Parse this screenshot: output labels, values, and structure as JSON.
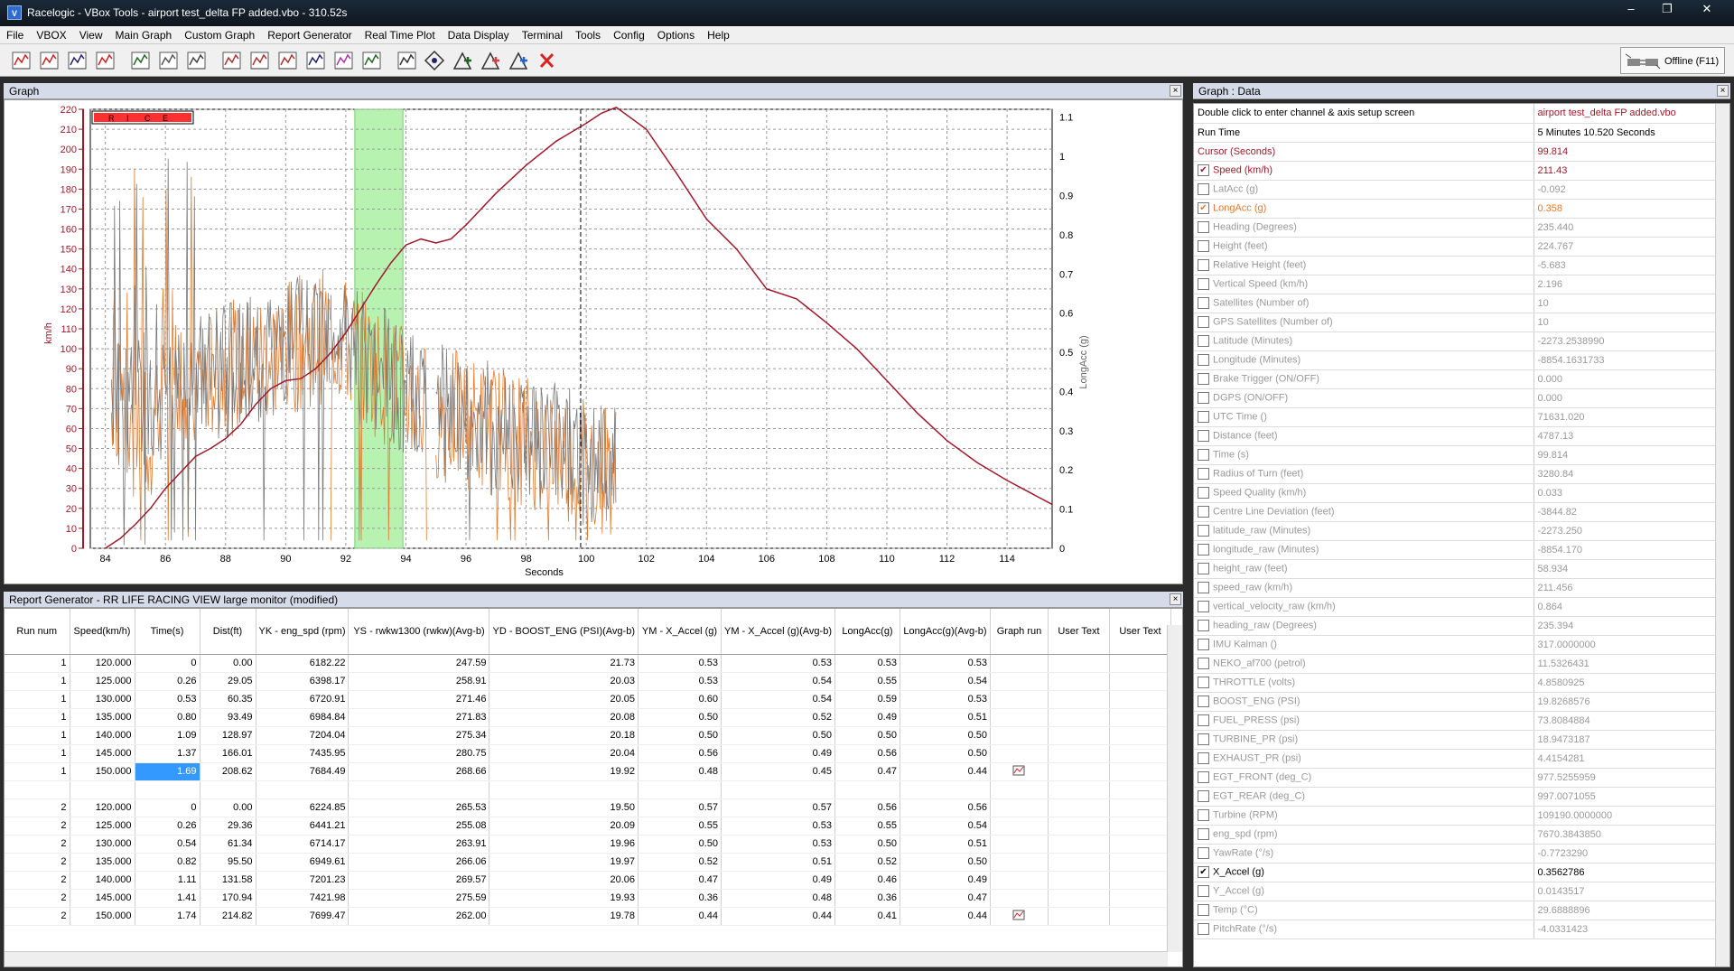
{
  "window": {
    "title": "Racelogic - VBox Tools - airport test_delta FP added.vbo - 310.52s",
    "icon": "V"
  },
  "menu": [
    "File",
    "VBOX",
    "View",
    "Main Graph",
    "Custom Graph",
    "Report Generator",
    "Real Time Plot",
    "Data Display",
    "Terminal",
    "Tools",
    "Config",
    "Options",
    "Help"
  ],
  "toolbar": {
    "icons": [
      "graph-icon",
      "graph-setup-icon",
      "zoom-graph-icon",
      "circle-graph-icon",
      "data-table-icon",
      "report-icon",
      "export-icon",
      "channel-icon",
      "channel-plot-icon",
      "lap-icon",
      "chart-icon",
      "cursor-icon",
      "map-icon",
      "table-icon",
      "compass-icon",
      "add-graph-icon",
      "add-graph-alt-icon",
      "add-graph-blue-icon",
      "delete-icon"
    ],
    "offline_label": "Offline (F11)"
  },
  "graph_panel": {
    "title": "Graph",
    "close": "×"
  },
  "report_panel": {
    "title": "Report Generator - RR LIFE RACING VIEW large monitor (modified)",
    "close": "×"
  },
  "data_panel": {
    "title": "Graph : Data",
    "close": "×"
  },
  "chart_data": {
    "type": "line",
    "xlabel": "Seconds",
    "ylabel_left": "km/h",
    "ylabel_right": "LongAcc (g)",
    "xlim": [
      83.5,
      115.5
    ],
    "ylim_left": [
      0,
      220
    ],
    "ylim_right": [
      0,
      1.12
    ],
    "x_ticks": [
      84,
      86,
      88,
      90,
      92,
      94,
      96,
      98,
      100,
      102,
      104,
      106,
      108,
      110,
      112,
      114
    ],
    "y_ticks_left": [
      0,
      10,
      20,
      30,
      40,
      50,
      60,
      70,
      80,
      90,
      100,
      110,
      120,
      130,
      140,
      150,
      160,
      170,
      180,
      190,
      200,
      210,
      220
    ],
    "y_ticks_right": [
      0,
      0.1,
      0.2,
      0.3,
      0.4,
      0.5,
      0.6,
      0.7,
      0.8,
      0.9,
      1,
      1.1
    ],
    "grid": true,
    "cursor_x": 99.814,
    "highlight_band": [
      92.3,
      93.9
    ],
    "legend_box": [
      "R",
      "I",
      "C",
      "E"
    ],
    "series": [
      {
        "name": "Speed (km/h)",
        "color": "#a0182a",
        "axis": "left",
        "x": [
          84,
          84.5,
          85,
          85.5,
          86,
          86.5,
          87,
          87.5,
          88,
          88.5,
          89,
          89.5,
          90,
          90.5,
          91,
          91.5,
          92,
          92.5,
          93,
          93.5,
          94,
          94.5,
          95,
          95.5,
          96,
          97,
          98,
          99,
          100,
          100.5,
          101,
          102,
          103,
          104,
          105,
          106,
          107,
          108,
          109,
          110,
          111,
          112,
          113,
          114,
          115,
          115.5
        ],
        "values": [
          0,
          5,
          12,
          20,
          30,
          38,
          46,
          50,
          55,
          62,
          72,
          80,
          84,
          85,
          90,
          98,
          108,
          120,
          132,
          143,
          152,
          155,
          153,
          155,
          162,
          178,
          192,
          204,
          213,
          218,
          221,
          210,
          188,
          165,
          150,
          130,
          125,
          113,
          100,
          84,
          68,
          54,
          43,
          34,
          26,
          22
        ]
      },
      {
        "name": "LongAcc (g)",
        "color": "#e07a2e",
        "axis": "right",
        "x": [],
        "values": []
      },
      {
        "name": "X_Accel (g)",
        "color": "#7a7a7a",
        "axis": "right",
        "x": [],
        "values": []
      }
    ]
  },
  "report": {
    "columns": [
      "Run num",
      "Speed(km/h)",
      "Time(s)",
      "Dist(ft)",
      "YK - eng_spd (rpm)",
      "YS - rwkw1300 (rwkw)(Avg-b)",
      "YD - BOOST_ENG (PSI)(Avg-b)",
      "YM - X_Accel (g)",
      "YM - X_Accel (g)(Avg-b)",
      "LongAcc(g)",
      "LongAcc(g)(Avg-b)",
      "Graph run",
      "User Text",
      "User Text"
    ],
    "rows": [
      [
        "1",
        "120.000",
        "0",
        "0.00",
        "6182.22",
        "247.59",
        "21.73",
        "0.53",
        "0.53",
        "0.53",
        "0.53",
        "",
        ""
      ],
      [
        "1",
        "125.000",
        "0.26",
        "29.05",
        "6398.17",
        "258.91",
        "20.03",
        "0.53",
        "0.54",
        "0.55",
        "0.54",
        "",
        ""
      ],
      [
        "1",
        "130.000",
        "0.53",
        "60.35",
        "6720.91",
        "271.46",
        "20.05",
        "0.60",
        "0.54",
        "0.59",
        "0.53",
        "",
        ""
      ],
      [
        "1",
        "135.000",
        "0.80",
        "93.49",
        "6984.84",
        "271.83",
        "20.08",
        "0.50",
        "0.52",
        "0.49",
        "0.51",
        "",
        ""
      ],
      [
        "1",
        "140.000",
        "1.09",
        "128.97",
        "7204.04",
        "275.34",
        "20.18",
        "0.50",
        "0.50",
        "0.50",
        "0.50",
        "",
        ""
      ],
      [
        "1",
        "145.000",
        "1.37",
        "166.01",
        "7435.95",
        "280.75",
        "20.04",
        "0.56",
        "0.49",
        "0.56",
        "0.50",
        "",
        ""
      ],
      [
        "1",
        "150.000",
        "1.69",
        "208.62",
        "7684.49",
        "268.66",
        "19.92",
        "0.48",
        "0.45",
        "0.47",
        "0.44",
        "icon",
        ""
      ],
      [
        "",
        "",
        "",
        "",
        "",
        "",
        "",
        "",
        "",
        "",
        "",
        "",
        ""
      ],
      [
        "2",
        "120.000",
        "0",
        "0.00",
        "6224.85",
        "265.53",
        "19.50",
        "0.57",
        "0.57",
        "0.56",
        "0.56",
        "",
        ""
      ],
      [
        "2",
        "125.000",
        "0.26",
        "29.36",
        "6441.21",
        "255.08",
        "20.09",
        "0.55",
        "0.53",
        "0.55",
        "0.54",
        "",
        ""
      ],
      [
        "2",
        "130.000",
        "0.54",
        "61.34",
        "6714.17",
        "263.91",
        "19.96",
        "0.50",
        "0.53",
        "0.50",
        "0.51",
        "",
        ""
      ],
      [
        "2",
        "135.000",
        "0.82",
        "95.50",
        "6949.61",
        "266.06",
        "19.97",
        "0.52",
        "0.51",
        "0.52",
        "0.50",
        "",
        ""
      ],
      [
        "2",
        "140.000",
        "1.11",
        "131.58",
        "7201.23",
        "269.57",
        "20.06",
        "0.47",
        "0.49",
        "0.46",
        "0.49",
        "",
        ""
      ],
      [
        "2",
        "145.000",
        "1.41",
        "170.94",
        "7421.98",
        "275.59",
        "19.93",
        "0.36",
        "0.48",
        "0.36",
        "0.47",
        "",
        ""
      ],
      [
        "2",
        "150.000",
        "1.74",
        "214.82",
        "7699.47",
        "262.00",
        "19.78",
        "0.44",
        "0.44",
        "0.41",
        "0.44",
        "icon",
        ""
      ]
    ]
  },
  "data": {
    "rows": [
      {
        "label": "Double click to enter channel & axis setup screen",
        "value": "airport test_delta FP added.vbo",
        "check": "none",
        "color": "#000",
        "vcolor": "#a0182a"
      },
      {
        "label": "Run Time",
        "value": "5 Minutes 10.520 Seconds",
        "check": "none",
        "color": "#000",
        "vcolor": "#000"
      },
      {
        "label": "Cursor (Seconds)",
        "value": "99.814",
        "check": "none",
        "color": "#a0182a",
        "vcolor": "#a0182a"
      },
      {
        "label": "Speed (km/h)",
        "value": "211.43",
        "check": "on",
        "color": "#a0182a",
        "vcolor": "#a0182a"
      },
      {
        "label": "LatAcc (g)",
        "value": "-0.092",
        "check": "off",
        "color": "#999",
        "vcolor": "#999"
      },
      {
        "label": "LongAcc (g)",
        "value": "0.358",
        "check": "on",
        "color": "#e07a2e",
        "vcolor": "#e07a2e"
      },
      {
        "label": "Heading (Degrees)",
        "value": "235.440",
        "check": "off",
        "color": "#999",
        "vcolor": "#999"
      },
      {
        "label": "Height (feet)",
        "value": "224.767",
        "check": "off",
        "color": "#999",
        "vcolor": "#999"
      },
      {
        "label": "Relative Height (feet)",
        "value": "-5.683",
        "check": "off",
        "color": "#999",
        "vcolor": "#999"
      },
      {
        "label": "Vertical Speed (km/h)",
        "value": "2.196",
        "check": "off",
        "color": "#999",
        "vcolor": "#999"
      },
      {
        "label": "Satellites (Number of)",
        "value": "10",
        "check": "off",
        "color": "#999",
        "vcolor": "#999"
      },
      {
        "label": "GPS Satellites (Number of)",
        "value": "10",
        "check": "off",
        "color": "#999",
        "vcolor": "#999"
      },
      {
        "label": "Latitude (Minutes)",
        "value": "-2273.2538990",
        "check": "off",
        "color": "#999",
        "vcolor": "#999"
      },
      {
        "label": "Longitude (Minutes)",
        "value": "-8854.1631733",
        "check": "off",
        "color": "#999",
        "vcolor": "#999"
      },
      {
        "label": "Brake Trigger (ON/OFF)",
        "value": "0.000",
        "check": "off",
        "color": "#999",
        "vcolor": "#999"
      },
      {
        "label": "DGPS (ON/OFF)",
        "value": "0.000",
        "check": "off",
        "color": "#999",
        "vcolor": "#999"
      },
      {
        "label": "UTC Time ()",
        "value": "71631.020",
        "check": "off",
        "color": "#999",
        "vcolor": "#999"
      },
      {
        "label": "Distance (feet)",
        "value": "4787.13",
        "check": "off",
        "color": "#999",
        "vcolor": "#999"
      },
      {
        "label": "Time (s)",
        "value": "99.814",
        "check": "off",
        "color": "#999",
        "vcolor": "#999"
      },
      {
        "label": "Radius of Turn (feet)",
        "value": "3280.84",
        "check": "off",
        "color": "#999",
        "vcolor": "#999"
      },
      {
        "label": "Speed Quality (km/h)",
        "value": "0.033",
        "check": "off",
        "color": "#999",
        "vcolor": "#999"
      },
      {
        "label": "Centre Line Deviation (feet)",
        "value": "-3844.82",
        "check": "off",
        "color": "#999",
        "vcolor": "#999"
      },
      {
        "label": "latitude_raw (Minutes)",
        "value": "-2273.250",
        "check": "off",
        "color": "#999",
        "vcolor": "#999"
      },
      {
        "label": "longitude_raw (Minutes)",
        "value": "-8854.170",
        "check": "off",
        "color": "#999",
        "vcolor": "#999"
      },
      {
        "label": "height_raw (feet)",
        "value": "58.934",
        "check": "off",
        "color": "#999",
        "vcolor": "#999"
      },
      {
        "label": "speed_raw (km/h)",
        "value": "211.456",
        "check": "off",
        "color": "#999",
        "vcolor": "#999"
      },
      {
        "label": "vertical_velocity_raw (km/h)",
        "value": "0.864",
        "check": "off",
        "color": "#999",
        "vcolor": "#999"
      },
      {
        "label": "heading_raw (Degrees)",
        "value": "235.394",
        "check": "off",
        "color": "#999",
        "vcolor": "#999"
      },
      {
        "label": "IMU Kalman ()",
        "value": "317.0000000",
        "check": "off",
        "color": "#999",
        "vcolor": "#999"
      },
      {
        "label": "NEKO_af700 (petrol)",
        "value": "11.5326431",
        "check": "off",
        "color": "#999",
        "vcolor": "#999"
      },
      {
        "label": "THROTTLE (volts)",
        "value": "4.8580925",
        "check": "off",
        "color": "#999",
        "vcolor": "#999"
      },
      {
        "label": "BOOST_ENG (PSI)",
        "value": "19.8268576",
        "check": "off",
        "color": "#999",
        "vcolor": "#999"
      },
      {
        "label": "FUEL_PRESS (psi)",
        "value": "73.8084884",
        "check": "off",
        "color": "#999",
        "vcolor": "#999"
      },
      {
        "label": "TURBINE_PR (psi)",
        "value": "18.9473187",
        "check": "off",
        "color": "#999",
        "vcolor": "#999"
      },
      {
        "label": "EXHAUST_PR (psi)",
        "value": "4.4154281",
        "check": "off",
        "color": "#999",
        "vcolor": "#999"
      },
      {
        "label": "EGT_FRONT (deg_C)",
        "value": "977.5255959",
        "check": "off",
        "color": "#999",
        "vcolor": "#999"
      },
      {
        "label": "EGT_REAR (deg_C)",
        "value": "997.0071055",
        "check": "off",
        "color": "#999",
        "vcolor": "#999"
      },
      {
        "label": "Turbine (RPM)",
        "value": "109190.0000000",
        "check": "off",
        "color": "#999",
        "vcolor": "#999"
      },
      {
        "label": "eng_spd (rpm)",
        "value": "7670.3843850",
        "check": "off",
        "color": "#999",
        "vcolor": "#999"
      },
      {
        "label": "YawRate (°/s)",
        "value": "-0.7723290",
        "check": "off",
        "color": "#999",
        "vcolor": "#999"
      },
      {
        "label": "X_Accel (g)",
        "value": "0.3562786",
        "check": "on",
        "color": "#000",
        "vcolor": "#000"
      },
      {
        "label": "Y_Accel (g)",
        "value": "0.0143517",
        "check": "off",
        "color": "#999",
        "vcolor": "#999"
      },
      {
        "label": "Temp (°C)",
        "value": "29.6888896",
        "check": "off",
        "color": "#999",
        "vcolor": "#999"
      },
      {
        "label": "PitchRate (°/s)",
        "value": "-4.0331423",
        "check": "off",
        "color": "#999",
        "vcolor": "#999"
      }
    ]
  }
}
